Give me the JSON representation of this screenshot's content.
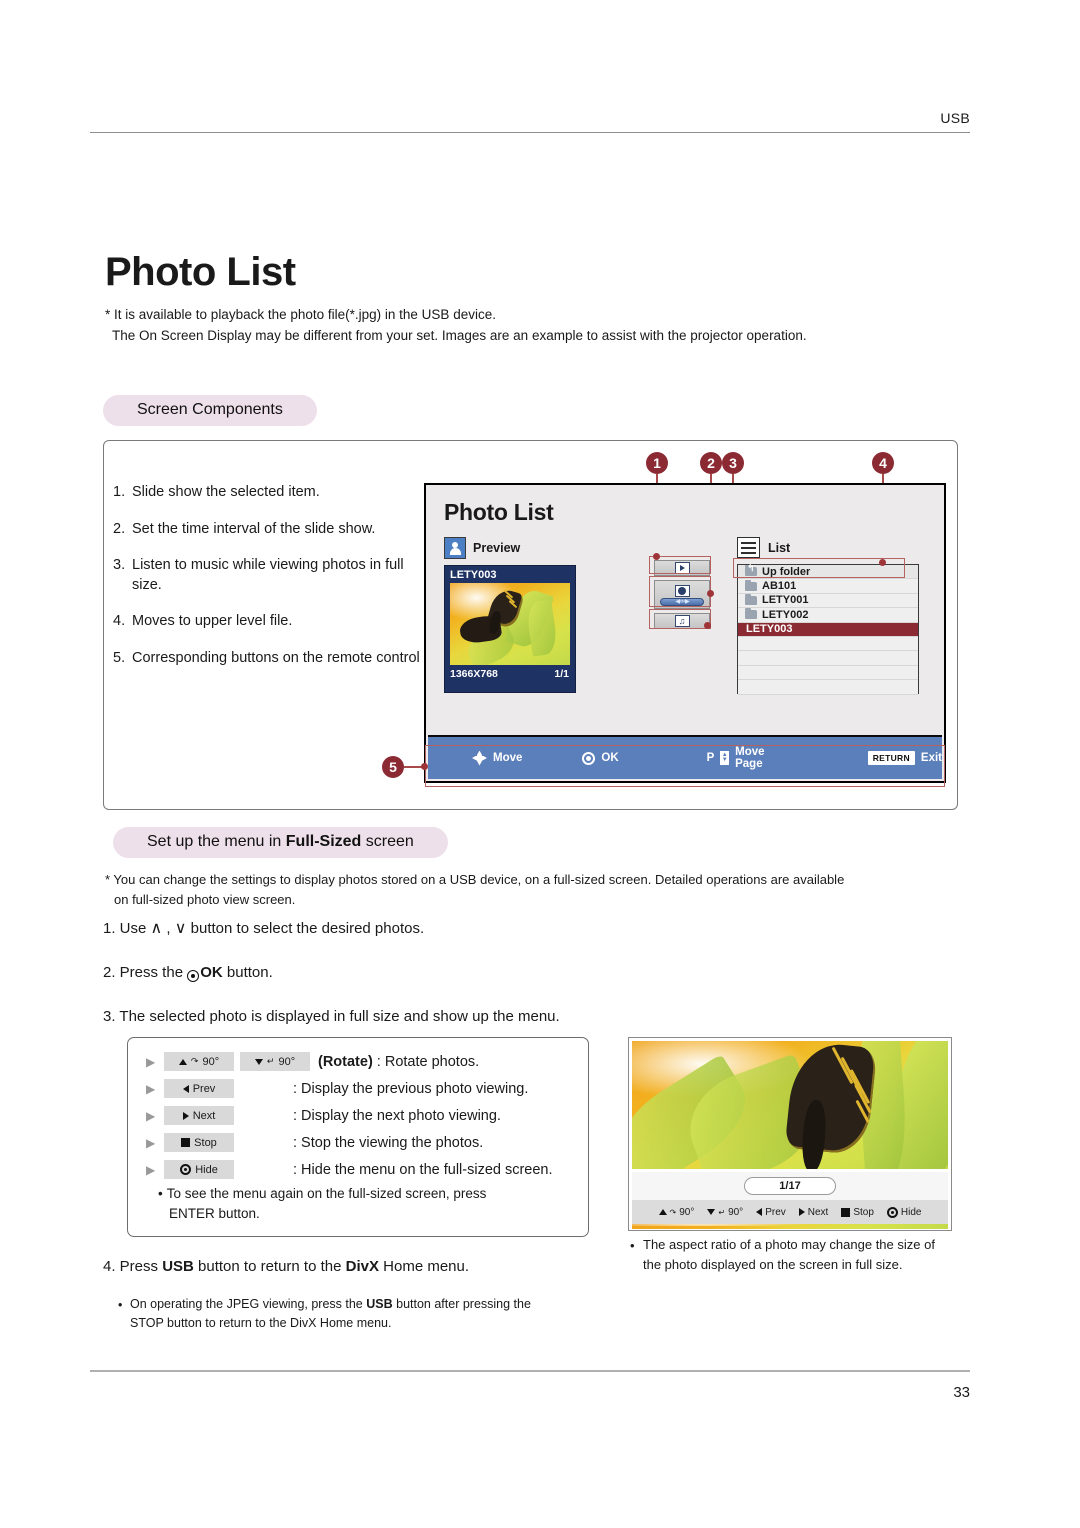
{
  "header": {
    "running_head": "USB"
  },
  "page_title": "Photo List",
  "intro": {
    "line1": "* It is available to playback the photo file(*.jpg) in the USB device.",
    "line2": "The On Screen Display may be different from your set. Images are an example to assist with the projector operation."
  },
  "sections": {
    "screen_components": "Screen Components",
    "fullsized_prefix": "Set up the menu in ",
    "fullsized_bold": "Full-Sized",
    "fullsized_suffix": " screen"
  },
  "numbered_list": [
    {
      "num": "1.",
      "text": "Slide show the selected item."
    },
    {
      "num": "2.",
      "text": "Set the time interval of the slide show."
    },
    {
      "num": "3.",
      "text": "Listen to music while viewing photos in full size."
    },
    {
      "num": "4.",
      "text": "Moves to upper level file."
    },
    {
      "num": "5.",
      "text": "Corresponding buttons on the remote control"
    }
  ],
  "callouts": [
    "1",
    "2",
    "3",
    "4",
    "5"
  ],
  "osd": {
    "title": "Photo List",
    "preview_label": "Preview",
    "preview": {
      "name": "LETY003",
      "resolution": "1366X768",
      "counter": "1/1"
    },
    "buttons": [
      {
        "name": "slideshow-button",
        "icon": "play-icon"
      },
      {
        "name": "timer-button",
        "icon": "clock-icon",
        "slider": "◀ »» ▶"
      },
      {
        "name": "music-button",
        "icon": "music-note-icon"
      }
    ],
    "list_label": "List",
    "list_items": [
      {
        "label": "Up folder",
        "icon": "up-folder-icon",
        "state": "upfolder"
      },
      {
        "label": "AB101",
        "icon": "folder-icon",
        "state": "normal"
      },
      {
        "label": "LETY001",
        "icon": "folder-icon",
        "state": "normal"
      },
      {
        "label": "LETY002",
        "icon": "folder-icon",
        "state": "normal"
      },
      {
        "label": "LETY003",
        "icon": "none",
        "state": "selected"
      }
    ],
    "empty_rows": 4,
    "guide_bar": [
      {
        "icon": "dpad-icon",
        "label": "Move"
      },
      {
        "icon": "ok-icon",
        "label": "OK"
      },
      {
        "icon": "p-updown-icon",
        "prefix": "P",
        "label": "Move Page"
      },
      {
        "icon": "return-key",
        "key": "RETURN",
        "label": "Exit"
      }
    ]
  },
  "fullsized": {
    "note_line1": "* You can change the settings to display photos stored on a  USB device, on a full-sized screen. Detailed operations are available",
    "note_line2": "on full-sized photo view screen.",
    "step1_a": "1. Use ",
    "step1_b": " , ",
    "step1_c": " button to select the desired photos.",
    "step2_a": "2. Press the ",
    "step2_bold": "OK",
    "step2_b": " button.",
    "step3": "3. The selected photo is displayed in full size and show up the menu.",
    "step4_a": "4. Press ",
    "step4_usb": "USB",
    "step4_b": " button to return to the ",
    "step4_divx": "DivX",
    "step4_c": " Home menu."
  },
  "keys": [
    {
      "cap1": "90°",
      "cap1_icon": "rotate-cw-icon",
      "cap2": "90°",
      "cap2_icon": "rotate-ccw-icon",
      "bold": "(Rotate)",
      "desc": " : Rotate photos."
    },
    {
      "cap1": "Prev",
      "cap1_icon": "prev-icon",
      "desc": ": Display the previous photo viewing."
    },
    {
      "cap1": "Next",
      "cap1_icon": "next-icon",
      "desc": ": Display the next photo viewing."
    },
    {
      "cap1": "Stop",
      "cap1_icon": "stop-icon",
      "desc": ": Stop the viewing the photos."
    },
    {
      "cap1": "Hide",
      "cap1_icon": "hide-ok-icon",
      "desc": ": Hide the menu on the full-sized screen."
    }
  ],
  "keys_note": {
    "bullet": "•",
    "line1": "To see the menu again on the full-sized screen, press",
    "line2": "ENTER button."
  },
  "photo_panel": {
    "counter": "1/17",
    "bar": [
      {
        "icon": "rotate-cw-icon",
        "label": "90°"
      },
      {
        "icon": "rotate-ccw-icon",
        "label": "90°"
      },
      {
        "icon": "prev-icon",
        "label": "Prev"
      },
      {
        "icon": "next-icon",
        "label": "Next"
      },
      {
        "icon": "stop-icon",
        "label": "Stop"
      },
      {
        "icon": "hide-ok-icon",
        "label": "Hide"
      }
    ]
  },
  "notes": {
    "jpeg": {
      "bullet": "•",
      "l1_a": "On operating the JPEG viewing, press the  ",
      "l1_usb": "USB",
      "l1_b": " button after pressing the",
      "l2": "STOP button to return to the DivX Home menu."
    },
    "aspect": {
      "bullet": "•",
      "text": "The aspect ratio of a photo may change the size of the photo displayed on the screen in full size."
    }
  },
  "footer": {
    "page_number": "33"
  },
  "colors": {
    "callout": "#8c2a33",
    "pill": "#eee0ea",
    "guide_bar": "#5b7fba",
    "selected_row": "#8c2a33",
    "preview_card": "#1f3264"
  }
}
